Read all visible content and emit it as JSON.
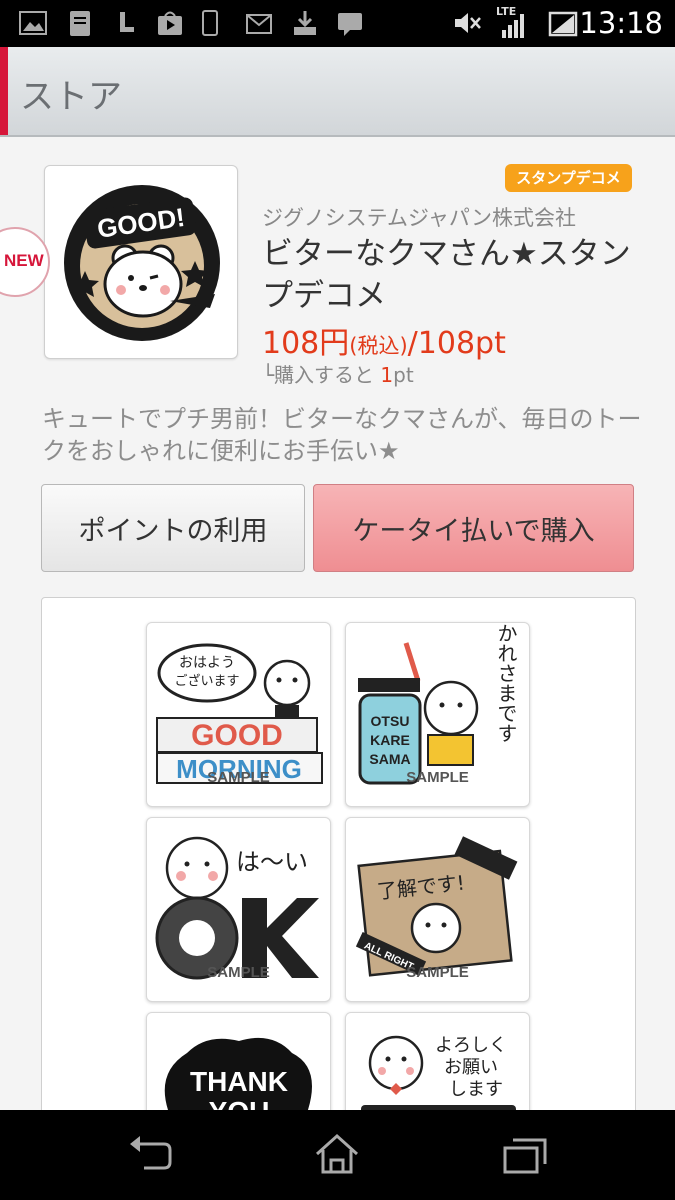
{
  "status_bar": {
    "time": "13:18",
    "network": "LTE",
    "icons": [
      "image-icon",
      "document-icon",
      "l-icon",
      "play-store-icon",
      "phone-icon",
      "mail-icon",
      "download-icon",
      "message-icon",
      "mute-icon",
      "signal-icon",
      "battery-icon"
    ]
  },
  "action_bar": {
    "title": "ストア",
    "accent_color": "#d6163a"
  },
  "product": {
    "badge": "NEW",
    "thumbnail_text": "GOOD!",
    "category": "スタンプデコメ",
    "company": "ジグノシステムジャパン株式会社",
    "title": "ビターなクマさん★スタンプデコメ",
    "price_yen": "108円",
    "price_tax": "(税込)",
    "price_pt": "/108pt",
    "points_prefix": "└購入すると ",
    "points_value": "1",
    "points_unit": "pt",
    "description": "キュートでプチ男前！ビターなクマさんが、毎日のトークをおしゃれに便利にお手伝い★"
  },
  "buttons": {
    "use_points": "ポイントの利用",
    "buy_carrier": "ケータイ払いで購入"
  },
  "samples": {
    "label": "SAMPLE",
    "items": [
      {
        "lines": [
          "おはよう",
          "ございます"
        ],
        "big": "GOOD MORNING"
      },
      {
        "lines": [
          "おつかれさまです"
        ],
        "big": "OTSU KARE SAMA"
      },
      {
        "lines": [
          "は〜い"
        ],
        "big": "OK"
      },
      {
        "lines": [
          "了解です!"
        ],
        "big": "ALL RIGHT"
      },
      {
        "lines": [],
        "big": "THANK YOU"
      },
      {
        "lines": [
          "よろしく",
          "お願い",
          "します"
        ],
        "big": ""
      }
    ]
  },
  "colors": {
    "price": "#e23b1b",
    "category_tag": "#f7a21b",
    "buy_button": "#ef8e92"
  }
}
